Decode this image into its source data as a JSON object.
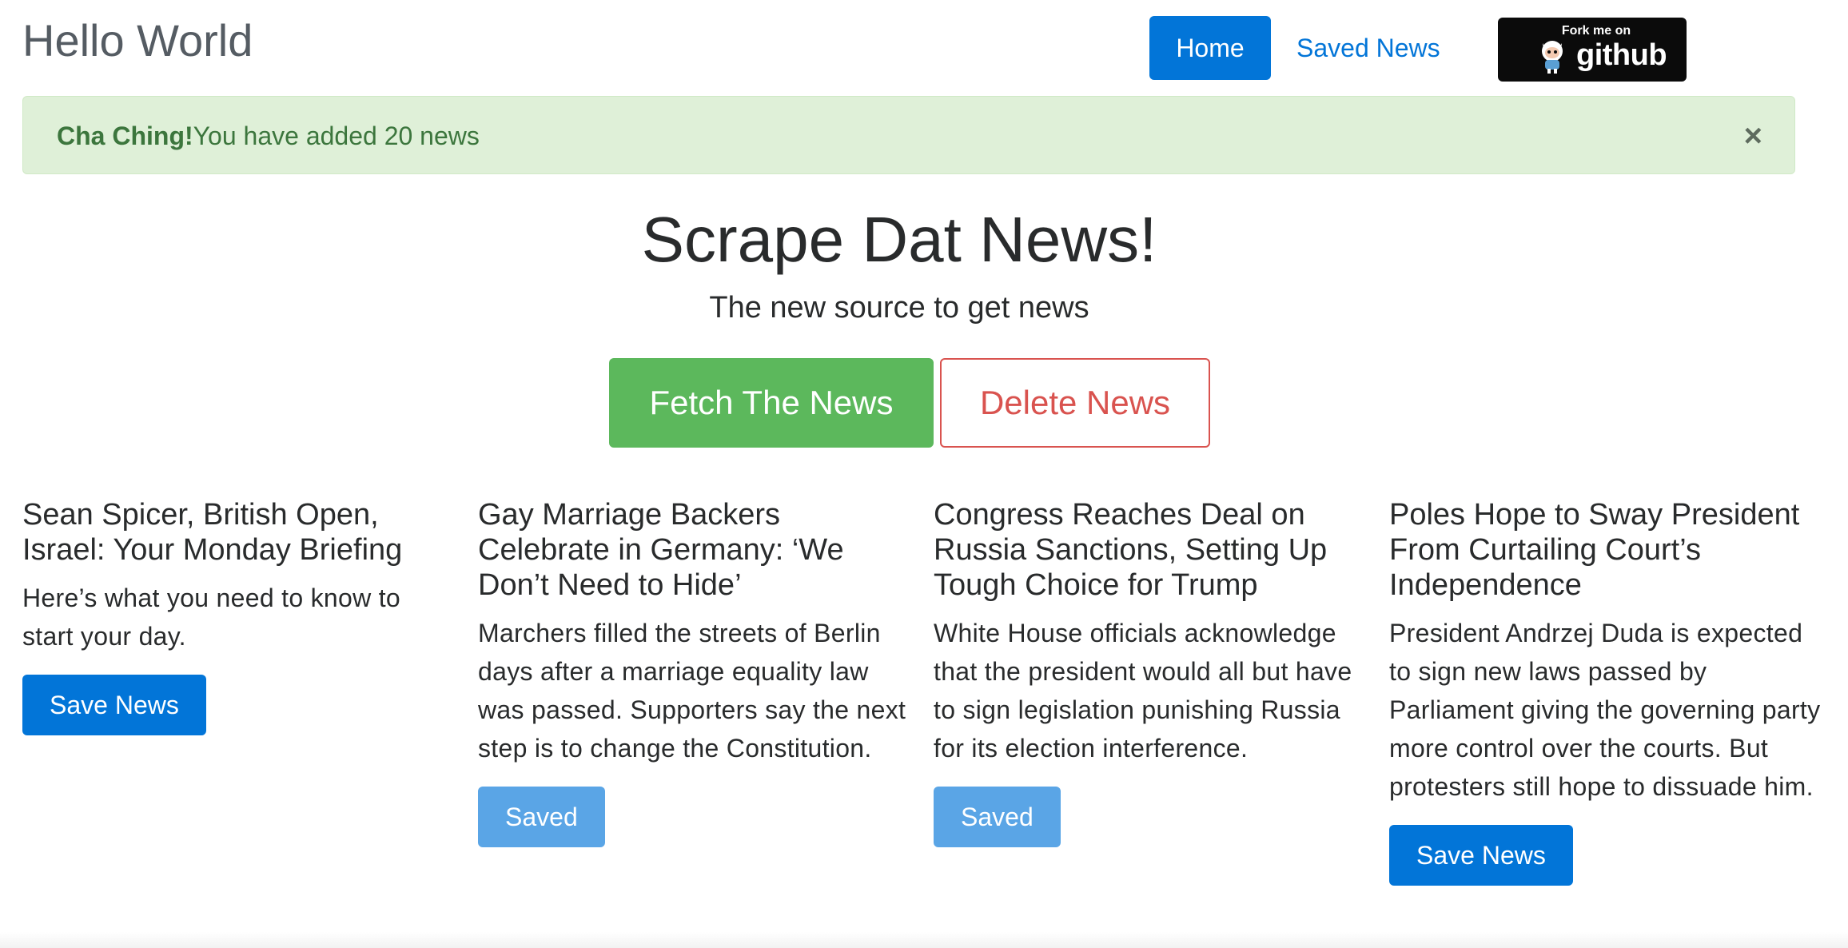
{
  "navbar": {
    "brand": "Hello World",
    "home_label": "Home",
    "saved_label": "Saved News",
    "github_badge": {
      "top_text": "Fork me on",
      "word": "github"
    }
  },
  "alert": {
    "strong": "Cha Ching!",
    "message": "You have added 20 news",
    "close_glyph": "×"
  },
  "jumbotron": {
    "title": "Scrape Dat News!",
    "subtitle": "The new source to get news",
    "fetch_label": "Fetch The News",
    "delete_label": "Delete News"
  },
  "articles": [
    {
      "title": "Sean Spicer, British Open, Israel: Your Monday Briefing",
      "summary": "Here’s what you need to know to start your day.",
      "button_label": "Save News",
      "saved": false
    },
    {
      "title": "Gay Marriage Backers Celebrate in Germany: ‘We Don’t Need to Hide’",
      "summary": "Marchers filled the streets of Berlin days after a marriage equality law was passed. Supporters say the next step is to change the Constitution.",
      "button_label": "Saved",
      "saved": true
    },
    {
      "title": "Congress Reaches Deal on Russia Sanctions, Setting Up Tough Choice for Trump",
      "summary": "White House officials acknowledge that the president would all but have to sign legislation punishing Russia for its election interference.",
      "button_label": "Saved",
      "saved": true
    },
    {
      "title": "Poles Hope to Sway President From Curtailing Court’s Independence",
      "summary": "President Andrzej Duda is expected to sign new laws passed by Parliament giving the governing party more control over the courts. But protesters still hope to dissuade him.",
      "button_label": "Save News",
      "saved": false
    }
  ],
  "colors": {
    "primary": "#0275d8",
    "success": "#5cb85c",
    "danger": "#d9534f",
    "alert_bg": "#dff0d8",
    "alert_text": "#3c763d",
    "saved_button": "#5aa5e6"
  },
  "icons": {
    "octocat": "octocat-icon",
    "close": "close-icon"
  }
}
